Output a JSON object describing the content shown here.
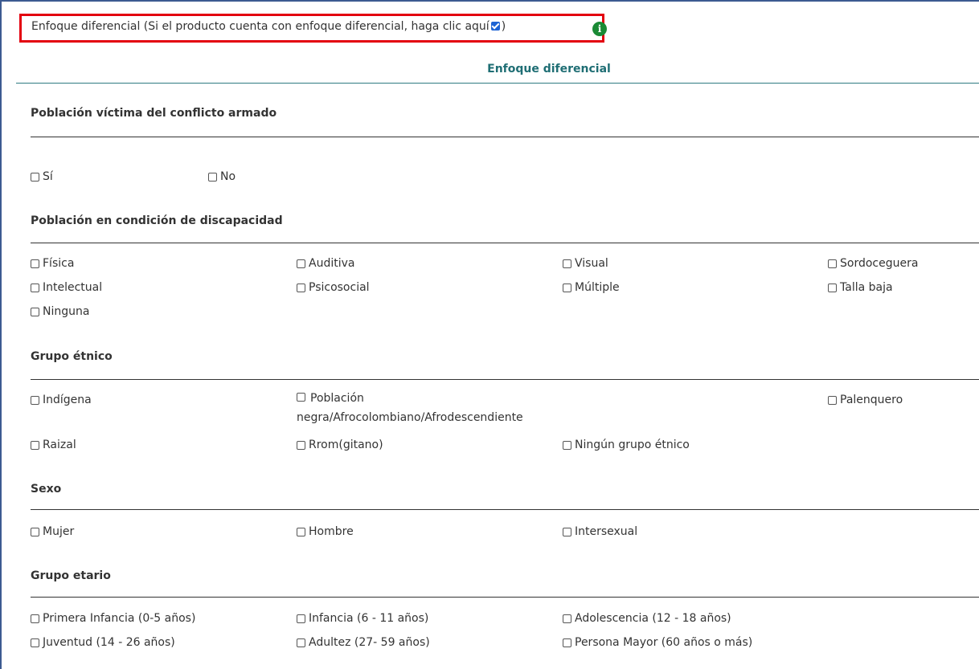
{
  "header": {
    "checkbox_label_before": "Enfoque diferencial (Si el producto cuenta con enfoque diferencial, haga clic aquí",
    "checkbox_label_after": ")",
    "checkbox_checked": true,
    "info_icon": "info-circle-icon"
  },
  "section_title": "Enfoque diferencial",
  "victima": {
    "title": "Población víctima del conflicto armado",
    "options": [
      "Sí",
      "No"
    ]
  },
  "discapacidad": {
    "title": "Población en condición de discapacidad",
    "options": [
      "Física",
      "Auditiva",
      "Visual",
      "Sordoceguera",
      "Intelectual",
      "Psicosocial",
      "Múltiple",
      "Talla baja",
      "Ninguna"
    ]
  },
  "etnico": {
    "title": "Grupo étnico",
    "options": [
      "Indígena",
      "Población negra/Afrocolombiano/Afrodescendiente",
      "Palenquero",
      "Raizal",
      "Rrom(gitano)",
      "Ningún grupo étnico"
    ]
  },
  "sexo": {
    "title": "Sexo",
    "options": [
      "Mujer",
      "Hombre",
      "Intersexual"
    ]
  },
  "etario": {
    "title": "Grupo etario",
    "options": [
      "Primera Infancia (0-5 años)",
      "Infancia (6 - 11 años)",
      "Adolescencia (12 - 18 años)",
      "Juventud (14 - 26 años)",
      "Adultez (27- 59 años)",
      "Persona Mayor (60 años o más)"
    ]
  },
  "colors": {
    "frame_border": "#3c5a91",
    "highlight_box": "#e3000f",
    "section_title": "#1f6e74",
    "info_icon": "#1a8a35",
    "checked_box": "#1e64d4"
  }
}
